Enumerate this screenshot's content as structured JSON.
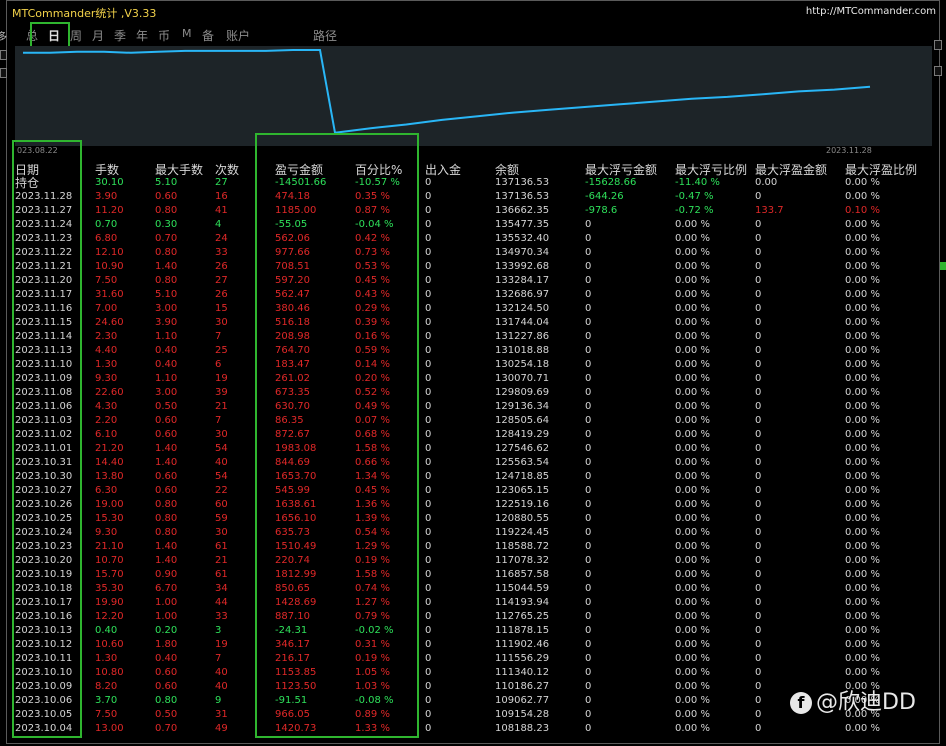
{
  "window": {
    "title": "MTCommander统计 ,V3.33",
    "url": "http://MTCommander.com"
  },
  "tabs": [
    "总",
    "日",
    "周",
    "月",
    "季",
    "年",
    "币",
    "M",
    "备",
    "账户",
    "路径"
  ],
  "active_tab": "日",
  "side_labels": {
    "left_top": "多"
  },
  "chart": {
    "start_date": "023.08.22",
    "end_date": "2023.11.28",
    "line_color": "#29b6f6",
    "grid": false,
    "y_values": [
      97,
      97,
      98,
      98,
      97,
      98,
      99,
      99,
      99,
      99,
      100,
      100,
      10,
      15,
      19,
      24,
      28,
      32,
      35,
      38,
      41,
      44,
      47,
      49,
      52,
      55,
      57,
      60
    ]
  },
  "columns": [
    "日期",
    "手数",
    "最大手数",
    "次数",
    "盈亏金额",
    "百分比%",
    "出入金",
    "余额",
    "最大浮亏金额",
    "最大浮亏比例",
    "最大浮盈金额",
    "最大浮盈比例"
  ],
  "rows": [
    [
      "持仓",
      "30.10",
      "5.10",
      "27",
      "-14501.66",
      "-10.57 %",
      "0",
      "137136.53",
      "-15628.66",
      "-11.40 %",
      "0.00",
      "0.00 %"
    ],
    [
      "2023.11.28",
      "3.90",
      "0.60",
      "16",
      "474.18",
      "0.35 %",
      "0",
      "137136.53",
      "-644.26",
      "-0.47 %",
      "0",
      "0.00 %"
    ],
    [
      "2023.11.27",
      "11.20",
      "0.80",
      "41",
      "1185.00",
      "0.87 %",
      "0",
      "136662.35",
      "-978.6",
      "-0.72 %",
      "133.7",
      "0.10 %"
    ],
    [
      "2023.11.24",
      "0.70",
      "0.30",
      "4",
      "-55.05",
      "-0.04 %",
      "0",
      "135477.35",
      "0",
      "0.00 %",
      "0",
      "0.00 %"
    ],
    [
      "2023.11.23",
      "6.80",
      "0.70",
      "24",
      "562.06",
      "0.42 %",
      "0",
      "135532.40",
      "0",
      "0.00 %",
      "0",
      "0.00 %"
    ],
    [
      "2023.11.22",
      "12.10",
      "0.80",
      "33",
      "977.66",
      "0.73 %",
      "0",
      "134970.34",
      "0",
      "0.00 %",
      "0",
      "0.00 %"
    ],
    [
      "2023.11.21",
      "10.90",
      "1.40",
      "26",
      "708.51",
      "0.53 %",
      "0",
      "133992.68",
      "0",
      "0.00 %",
      "0",
      "0.00 %"
    ],
    [
      "2023.11.20",
      "7.50",
      "0.80",
      "27",
      "597.20",
      "0.45 %",
      "0",
      "133284.17",
      "0",
      "0.00 %",
      "0",
      "0.00 %"
    ],
    [
      "2023.11.17",
      "31.60",
      "5.10",
      "26",
      "562.47",
      "0.43 %",
      "0",
      "132686.97",
      "0",
      "0.00 %",
      "0",
      "0.00 %"
    ],
    [
      "2023.11.16",
      "7.00",
      "3.00",
      "15",
      "380.46",
      "0.29 %",
      "0",
      "132124.50",
      "0",
      "0.00 %",
      "0",
      "0.00 %"
    ],
    [
      "2023.11.15",
      "24.60",
      "3.90",
      "30",
      "516.18",
      "0.39 %",
      "0",
      "131744.04",
      "0",
      "0.00 %",
      "0",
      "0.00 %"
    ],
    [
      "2023.11.14",
      "2.30",
      "1.10",
      "7",
      "208.98",
      "0.16 %",
      "0",
      "131227.86",
      "0",
      "0.00 %",
      "0",
      "0.00 %"
    ],
    [
      "2023.11.13",
      "4.40",
      "0.40",
      "25",
      "764.70",
      "0.59 %",
      "0",
      "131018.88",
      "0",
      "0.00 %",
      "0",
      "0.00 %"
    ],
    [
      "2023.11.10",
      "1.30",
      "0.40",
      "6",
      "183.47",
      "0.14 %",
      "0",
      "130254.18",
      "0",
      "0.00 %",
      "0",
      "0.00 %"
    ],
    [
      "2023.11.09",
      "9.30",
      "1.10",
      "19",
      "261.02",
      "0.20 %",
      "0",
      "130070.71",
      "0",
      "0.00 %",
      "0",
      "0.00 %"
    ],
    [
      "2023.11.08",
      "22.60",
      "3.00",
      "39",
      "673.35",
      "0.52 %",
      "0",
      "129809.69",
      "0",
      "0.00 %",
      "0",
      "0.00 %"
    ],
    [
      "2023.11.06",
      "4.30",
      "0.50",
      "21",
      "630.70",
      "0.49 %",
      "0",
      "129136.34",
      "0",
      "0.00 %",
      "0",
      "0.00 %"
    ],
    [
      "2023.11.03",
      "2.20",
      "0.60",
      "7",
      "86.35",
      "0.07 %",
      "0",
      "128505.64",
      "0",
      "0.00 %",
      "0",
      "0.00 %"
    ],
    [
      "2023.11.02",
      "6.10",
      "0.60",
      "30",
      "872.67",
      "0.68 %",
      "0",
      "128419.29",
      "0",
      "0.00 %",
      "0",
      "0.00 %"
    ],
    [
      "2023.11.01",
      "21.20",
      "1.40",
      "54",
      "1983.08",
      "1.58 %",
      "0",
      "127546.62",
      "0",
      "0.00 %",
      "0",
      "0.00 %"
    ],
    [
      "2023.10.31",
      "14.40",
      "1.40",
      "40",
      "844.69",
      "0.66 %",
      "0",
      "125563.54",
      "0",
      "0.00 %",
      "0",
      "0.00 %"
    ],
    [
      "2023.10.30",
      "13.80",
      "0.60",
      "54",
      "1653.70",
      "1.34 %",
      "0",
      "124718.85",
      "0",
      "0.00 %",
      "0",
      "0.00 %"
    ],
    [
      "2023.10.27",
      "6.30",
      "0.60",
      "22",
      "545.99",
      "0.45 %",
      "0",
      "123065.15",
      "0",
      "0.00 %",
      "0",
      "0.00 %"
    ],
    [
      "2023.10.26",
      "19.00",
      "0.80",
      "60",
      "1638.61",
      "1.36 %",
      "0",
      "122519.16",
      "0",
      "0.00 %",
      "0",
      "0.00 %"
    ],
    [
      "2023.10.25",
      "15.30",
      "0.80",
      "59",
      "1656.10",
      "1.39 %",
      "0",
      "120880.55",
      "0",
      "0.00 %",
      "0",
      "0.00 %"
    ],
    [
      "2023.10.24",
      "9.30",
      "0.80",
      "30",
      "635.73",
      "0.54 %",
      "0",
      "119224.45",
      "0",
      "0.00 %",
      "0",
      "0.00 %"
    ],
    [
      "2023.10.23",
      "21.10",
      "1.40",
      "61",
      "1510.49",
      "1.29 %",
      "0",
      "118588.72",
      "0",
      "0.00 %",
      "0",
      "0.00 %"
    ],
    [
      "2023.10.20",
      "10.70",
      "1.40",
      "21",
      "220.74",
      "0.19 %",
      "0",
      "117078.32",
      "0",
      "0.00 %",
      "0",
      "0.00 %"
    ],
    [
      "2023.10.19",
      "15.70",
      "0.90",
      "61",
      "1812.99",
      "1.58 %",
      "0",
      "116857.58",
      "0",
      "0.00 %",
      "0",
      "0.00 %"
    ],
    [
      "2023.10.18",
      "35.30",
      "6.70",
      "34",
      "850.65",
      "0.74 %",
      "0",
      "115044.59",
      "0",
      "0.00 %",
      "0",
      "0.00 %"
    ],
    [
      "2023.10.17",
      "19.90",
      "1.00",
      "44",
      "1428.69",
      "1.27 %",
      "0",
      "114193.94",
      "0",
      "0.00 %",
      "0",
      "0.00 %"
    ],
    [
      "2023.10.16",
      "12.20",
      "1.00",
      "33",
      "887.10",
      "0.79 %",
      "0",
      "112765.25",
      "0",
      "0.00 %",
      "0",
      "0.00 %"
    ],
    [
      "2023.10.13",
      "0.40",
      "0.20",
      "3",
      "-24.31",
      "-0.02 %",
      "0",
      "111878.15",
      "0",
      "0.00 %",
      "0",
      "0.00 %"
    ],
    [
      "2023.10.12",
      "10.60",
      "1.80",
      "19",
      "346.17",
      "0.31 %",
      "0",
      "111902.46",
      "0",
      "0.00 %",
      "0",
      "0.00 %"
    ],
    [
      "2023.10.11",
      "1.30",
      "0.40",
      "7",
      "216.17",
      "0.19 %",
      "0",
      "111556.29",
      "0",
      "0.00 %",
      "0",
      "0.00 %"
    ],
    [
      "2023.10.10",
      "10.80",
      "0.60",
      "40",
      "1153.85",
      "1.05 %",
      "0",
      "111340.12",
      "0",
      "0.00 %",
      "0",
      "0.00 %"
    ],
    [
      "2023.10.09",
      "8.20",
      "0.60",
      "40",
      "1123.50",
      "1.03 %",
      "0",
      "110186.27",
      "0",
      "0.00 %",
      "0",
      "0.00 %"
    ],
    [
      "2023.10.06",
      "3.70",
      "0.80",
      "9",
      "-91.51",
      "-0.08 %",
      "0",
      "109062.77",
      "0",
      "0.00 %",
      "0",
      "0.00 %"
    ],
    [
      "2023.10.05",
      "7.50",
      "0.50",
      "31",
      "966.05",
      "0.89 %",
      "0",
      "109154.28",
      "0",
      "0.00 %",
      "0",
      "0.00 %"
    ],
    [
      "2023.10.04",
      "13.00",
      "0.70",
      "49",
      "1420.73",
      "1.33 %",
      "0",
      "108188.23",
      "0",
      "0.00 %",
      "0",
      "0.00 %"
    ]
  ],
  "colors": {
    "positive": "#e02828",
    "negative": "#2ee05a",
    "neutral": "#d4d4d4",
    "highlight": "#2fb52f"
  },
  "watermark": {
    "icon": "zhihu-icon",
    "text": "@欣迪DD"
  }
}
